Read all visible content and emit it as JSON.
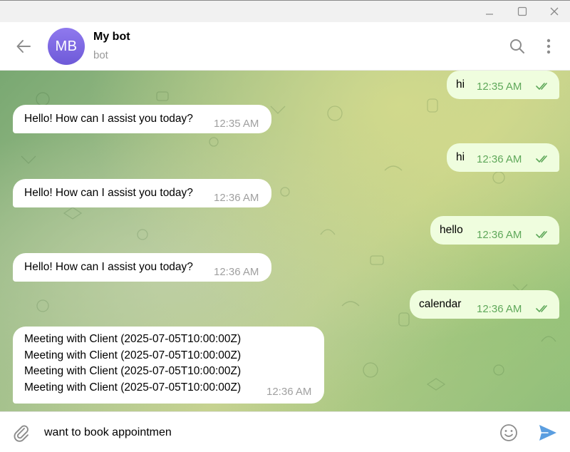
{
  "chat": {
    "avatar_initials": "MB",
    "title": "My bot",
    "subtitle": "bot"
  },
  "messages": [
    {
      "direction": "out",
      "text": "hi",
      "time": "12:35 AM",
      "read": true
    },
    {
      "direction": "in",
      "text": "Hello! How can I assist you today?",
      "time": "12:35 AM"
    },
    {
      "direction": "out",
      "text": "hi",
      "time": "12:36 AM",
      "read": true
    },
    {
      "direction": "in",
      "text": "Hello! How can I assist you today?",
      "time": "12:36 AM"
    },
    {
      "direction": "out",
      "text": "hello",
      "time": "12:36 AM",
      "read": true
    },
    {
      "direction": "in",
      "text": "Hello! How can I assist you today?",
      "time": "12:36 AM"
    },
    {
      "direction": "out",
      "text": "calendar",
      "time": "12:36 AM",
      "read": true
    },
    {
      "direction": "in",
      "lines": [
        "Meeting with Client (2025-07-05T10:00:00Z)",
        "Meeting with Client (2025-07-05T10:00:00Z)",
        "Meeting with Client (2025-07-05T10:00:00Z)",
        "Meeting with Client (2025-07-05T10:00:00Z)"
      ],
      "time": "12:36 AM"
    }
  ],
  "composer": {
    "value": "want to book appointmen"
  },
  "colors": {
    "avatar": "#7b66e3",
    "outgoing_bubble": "#effdde",
    "incoming_bubble": "#ffffff",
    "read_ticks": "#5fa85a",
    "send_icon": "#5b9ee0"
  },
  "icons": {
    "back": "arrow-left-icon",
    "search": "search-icon",
    "menu": "more-vertical-icon",
    "attach": "paperclip-icon",
    "emoji": "smiley-icon",
    "send": "send-icon"
  }
}
